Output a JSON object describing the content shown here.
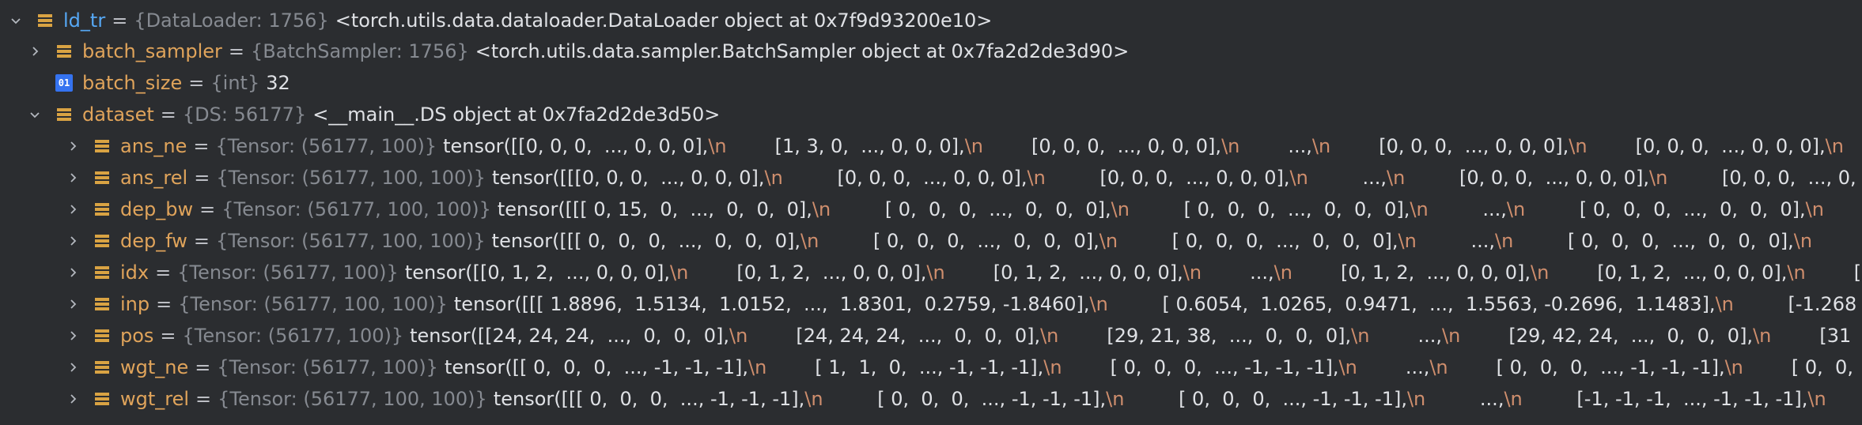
{
  "rows": [
    {
      "name": "ld_tr",
      "type": "{DataLoader: 1756}",
      "segments": [
        {
          "t": "<torch.utils.data.dataloader.DataLoader object at 0x7f9d93200e10>"
        }
      ]
    },
    {
      "name": "batch_sampler",
      "type": "{BatchSampler: 1756}",
      "segments": [
        {
          "t": "<torch.utils.data.sampler.BatchSampler object at 0x7fa2d2de3d90>"
        }
      ]
    },
    {
      "name": "batch_size",
      "type": "{int}",
      "segments": [
        {
          "t": "32"
        }
      ]
    },
    {
      "name": "dataset",
      "type": "{DS: 56177}",
      "segments": [
        {
          "t": "<__main__.DS object at 0x7fa2d2de3d50>"
        }
      ]
    },
    {
      "name": "ans_ne",
      "type": "{Tensor: (56177, 100)}",
      "segments": [
        {
          "t": "tensor([[0, 0, 0,  ..., 0, 0, 0],"
        },
        {
          "n": "\\n"
        },
        {
          "t": "        [1, 3, 0,  ..., 0, 0, 0],"
        },
        {
          "n": "\\n"
        },
        {
          "t": "        [0, 0, 0,  ..., 0, 0, 0],"
        },
        {
          "n": "\\n"
        },
        {
          "t": "        ...,"
        },
        {
          "n": "\\n"
        },
        {
          "t": "        [0, 0, 0,  ..., 0, 0, 0],"
        },
        {
          "n": "\\n"
        },
        {
          "t": "        [0, 0, 0,  ..., 0, 0, 0],"
        },
        {
          "n": "\\n"
        }
      ]
    },
    {
      "name": "ans_rel",
      "type": "{Tensor: (56177, 100, 100)}",
      "segments": [
        {
          "t": "tensor([[[0, 0, 0,  ..., 0, 0, 0],"
        },
        {
          "n": "\\n"
        },
        {
          "t": "         [0, 0, 0,  ..., 0, 0, 0],"
        },
        {
          "n": "\\n"
        },
        {
          "t": "         [0, 0, 0,  ..., 0, 0, 0],"
        },
        {
          "n": "\\n"
        },
        {
          "t": "         ...,"
        },
        {
          "n": "\\n"
        },
        {
          "t": "         [0, 0, 0,  ..., 0, 0, 0],"
        },
        {
          "n": "\\n"
        },
        {
          "t": "         [0, 0, 0,  ..., 0,"
        }
      ]
    },
    {
      "name": "dep_bw",
      "type": "{Tensor: (56177, 100, 100)}",
      "segments": [
        {
          "t": "tensor([[[ 0, 15,  0,  ...,  0,  0,  0],"
        },
        {
          "n": "\\n"
        },
        {
          "t": "         [ 0,  0,  0,  ...,  0,  0,  0],"
        },
        {
          "n": "\\n"
        },
        {
          "t": "         [ 0,  0,  0,  ...,  0,  0,  0],"
        },
        {
          "n": "\\n"
        },
        {
          "t": "         ...,"
        },
        {
          "n": "\\n"
        },
        {
          "t": "         [ 0,  0,  0,  ...,  0,  0,  0],"
        },
        {
          "n": "\\n"
        }
      ]
    },
    {
      "name": "dep_fw",
      "type": "{Tensor: (56177, 100, 100)}",
      "segments": [
        {
          "t": "tensor([[[ 0,  0,  0,  ...,  0,  0,  0],"
        },
        {
          "n": "\\n"
        },
        {
          "t": "         [ 0,  0,  0,  ...,  0,  0,  0],"
        },
        {
          "n": "\\n"
        },
        {
          "t": "         [ 0,  0,  0,  ...,  0,  0,  0],"
        },
        {
          "n": "\\n"
        },
        {
          "t": "         ...,"
        },
        {
          "n": "\\n"
        },
        {
          "t": "         [ 0,  0,  0,  ...,  0,  0,  0],"
        },
        {
          "n": "\\n"
        }
      ]
    },
    {
      "name": "idx",
      "type": "{Tensor: (56177, 100)}",
      "segments": [
        {
          "t": "tensor([[0, 1, 2,  ..., 0, 0, 0],"
        },
        {
          "n": "\\n"
        },
        {
          "t": "        [0, 1, 2,  ..., 0, 0, 0],"
        },
        {
          "n": "\\n"
        },
        {
          "t": "        [0, 1, 2,  ..., 0, 0, 0],"
        },
        {
          "n": "\\n"
        },
        {
          "t": "        ...,"
        },
        {
          "n": "\\n"
        },
        {
          "t": "        [0, 1, 2,  ..., 0, 0, 0],"
        },
        {
          "n": "\\n"
        },
        {
          "t": "        [0, 1, 2,  ..., 0, 0, 0],"
        },
        {
          "n": "\\n"
        },
        {
          "t": "        [0"
        }
      ]
    },
    {
      "name": "inp",
      "type": "{Tensor: (56177, 100, 100)}",
      "segments": [
        {
          "t": "tensor([[[ 1.8896,  1.5134,  1.0152,  ...,  1.8301,  0.2759, -1.8460],"
        },
        {
          "n": "\\n"
        },
        {
          "t": "         [ 0.6054,  1.0265,  0.9471,  ...,  1.5563, -0.2696,  1.1483],"
        },
        {
          "n": "\\n"
        },
        {
          "t": "         [-1.268"
        }
      ]
    },
    {
      "name": "pos",
      "type": "{Tensor: (56177, 100)}",
      "segments": [
        {
          "t": "tensor([[24, 24, 24,  ...,  0,  0,  0],"
        },
        {
          "n": "\\n"
        },
        {
          "t": "        [24, 24, 24,  ...,  0,  0,  0],"
        },
        {
          "n": "\\n"
        },
        {
          "t": "        [29, 21, 38,  ...,  0,  0,  0],"
        },
        {
          "n": "\\n"
        },
        {
          "t": "        ...,"
        },
        {
          "n": "\\n"
        },
        {
          "t": "        [29, 42, 24,  ...,  0,  0,  0],"
        },
        {
          "n": "\\n"
        },
        {
          "t": "        [31"
        }
      ]
    },
    {
      "name": "wgt_ne",
      "type": "{Tensor: (56177, 100)}",
      "segments": [
        {
          "t": "tensor([[ 0,  0,  0,  ..., -1, -1, -1],"
        },
        {
          "n": "\\n"
        },
        {
          "t": "        [ 1,  1,  0,  ..., -1, -1, -1],"
        },
        {
          "n": "\\n"
        },
        {
          "t": "        [ 0,  0,  0,  ..., -1, -1, -1],"
        },
        {
          "n": "\\n"
        },
        {
          "t": "        ...,"
        },
        {
          "n": "\\n"
        },
        {
          "t": "        [ 0,  0,  0,  ..., -1, -1, -1],"
        },
        {
          "n": "\\n"
        },
        {
          "t": "        [ 0,  0,"
        }
      ]
    },
    {
      "name": "wgt_rel",
      "type": "{Tensor: (56177, 100, 100)}",
      "segments": [
        {
          "t": "tensor([[[ 0,  0,  0,  ..., -1, -1, -1],"
        },
        {
          "n": "\\n"
        },
        {
          "t": "         [ 0,  0,  0,  ..., -1, -1, -1],"
        },
        {
          "n": "\\n"
        },
        {
          "t": "         [ 0,  0,  0,  ..., -1, -1, -1],"
        },
        {
          "n": "\\n"
        },
        {
          "t": "         ...,"
        },
        {
          "n": "\\n"
        },
        {
          "t": "         [-1, -1, -1,  ..., -1, -1, -1],"
        },
        {
          "n": "\\n"
        }
      ]
    }
  ],
  "colors": {
    "background": "#2b2d30",
    "variable_name": "#56a8f5",
    "attribute_name": "#e0a45b",
    "type_hint": "#868a91",
    "newline_escape": "#cf8e6d",
    "field_icon": "#d9a343",
    "primitive_icon": "#3573f0"
  },
  "icons": {
    "expand": "chevron-right-icon",
    "collapse": "chevron-down-icon",
    "object": "field-object-icon",
    "primitive": "primitive-int-icon"
  }
}
